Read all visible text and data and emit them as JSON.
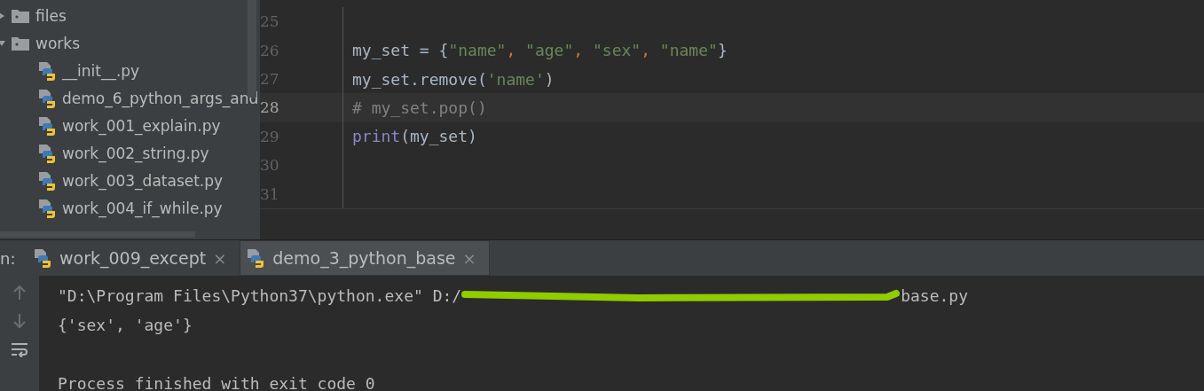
{
  "project_tree": {
    "items": [
      {
        "label": "files",
        "kind": "folder",
        "expanded": false
      },
      {
        "label": "works",
        "kind": "folder",
        "expanded": true,
        "children": [
          {
            "label": "__init__.py",
            "kind": "python"
          },
          {
            "label": "demo_6_python_args_and",
            "kind": "python"
          },
          {
            "label": "work_001_explain.py",
            "kind": "python"
          },
          {
            "label": "work_002_string.py",
            "kind": "python"
          },
          {
            "label": "work_003_dataset.py",
            "kind": "python"
          },
          {
            "label": "work_004_if_while.py",
            "kind": "python"
          }
        ]
      }
    ]
  },
  "editor": {
    "lines": [
      {
        "number": "25",
        "current": false
      },
      {
        "number": "26",
        "current": false,
        "tokens": [
          {
            "kind": "plain",
            "text": "my_set = {"
          },
          {
            "kind": "string",
            "text": "\"name\""
          },
          {
            "kind": "punct",
            "text": ", "
          },
          {
            "kind": "string",
            "text": "\"age\""
          },
          {
            "kind": "punct",
            "text": ", "
          },
          {
            "kind": "string",
            "text": "\"sex\""
          },
          {
            "kind": "punct",
            "text": ", "
          },
          {
            "kind": "string",
            "text": "\"name\""
          },
          {
            "kind": "plain",
            "text": "}"
          }
        ]
      },
      {
        "number": "27",
        "current": false,
        "tokens": [
          {
            "kind": "plain",
            "text": "my_set.remove("
          },
          {
            "kind": "string",
            "text": "'name'"
          },
          {
            "kind": "plain",
            "text": ")"
          }
        ]
      },
      {
        "number": "28",
        "current": true,
        "tokens": [
          {
            "kind": "comment",
            "text": "# my_set.pop()"
          }
        ]
      },
      {
        "number": "29",
        "current": false,
        "tokens": [
          {
            "kind": "builtin",
            "text": "print"
          },
          {
            "kind": "plain",
            "text": "(my_set)"
          }
        ]
      },
      {
        "number": "30",
        "current": false
      },
      {
        "number": "31",
        "current": false
      }
    ]
  },
  "run_panel": {
    "label": "n:",
    "tabs": [
      {
        "label": "work_009_except",
        "close": "×",
        "selected": false
      },
      {
        "label": "demo_3_python_base",
        "close": "×",
        "selected": true
      }
    ],
    "console": [
      {
        "kind": "command",
        "text": "\"D:\\Program Files\\Python37\\python.exe\" D:/",
        "tail": "base.py"
      },
      {
        "kind": "output",
        "text": "{'sex', 'age'}"
      },
      {
        "kind": "blank"
      },
      {
        "kind": "output",
        "text": "Process finished with exit code 0"
      }
    ]
  }
}
